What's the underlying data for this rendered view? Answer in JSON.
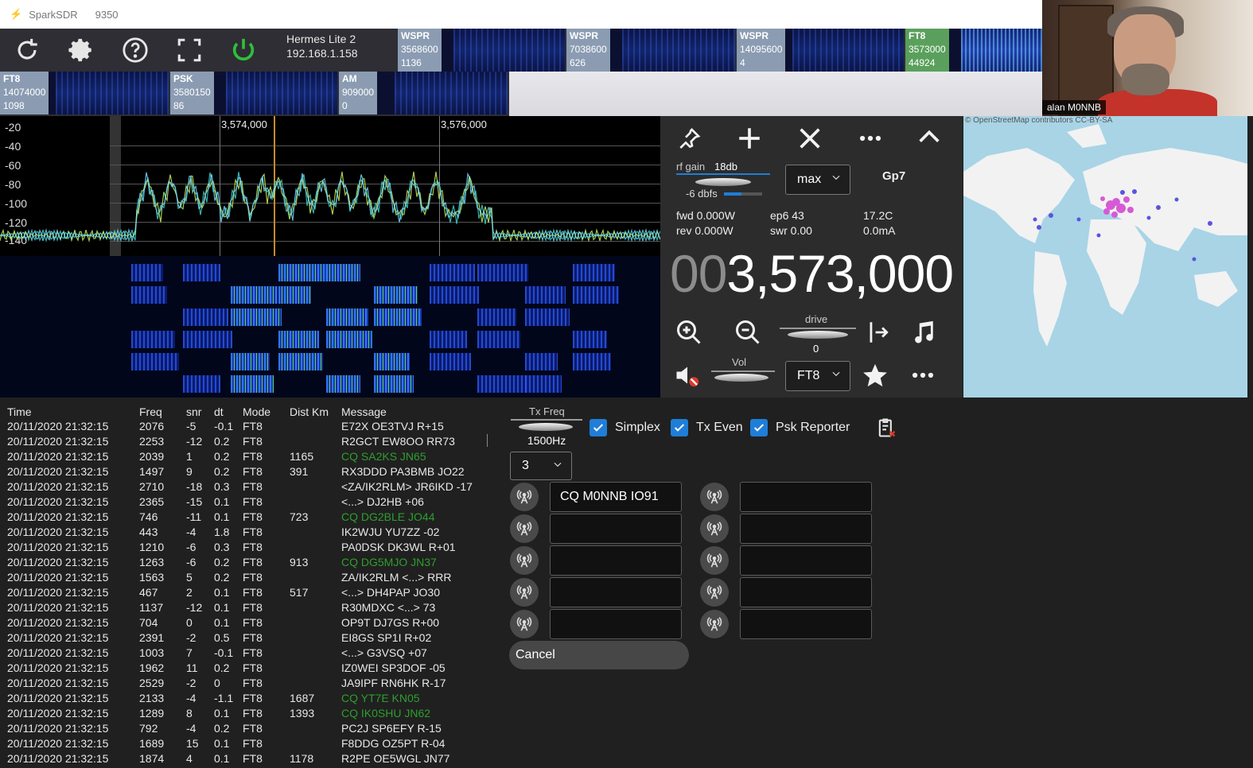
{
  "titlebar": {
    "app": "SparkSDR",
    "number": "9350"
  },
  "radio": {
    "name": "Hermes Lite 2",
    "ip": "192.168.1.158"
  },
  "tiles_row1": [
    {
      "mode": "WSPR",
      "freq": "3568600",
      "count": "1136",
      "green": false
    },
    {
      "mode": "WSPR",
      "freq": "7038600",
      "count": "626",
      "green": false
    },
    {
      "mode": "WSPR",
      "freq": "14095600",
      "count": "4",
      "green": false
    },
    {
      "mode": "FT8",
      "freq": "3573000",
      "count": "44924",
      "green": true
    }
  ],
  "tiles_row2": [
    {
      "mode": "FT8",
      "freq": "14074000",
      "count": "1098",
      "green": false
    },
    {
      "mode": "PSK",
      "freq": "3580150",
      "count": "86",
      "green": false
    },
    {
      "mode": "AM",
      "freq": "909000",
      "count": "0",
      "green": false
    }
  ],
  "video": {
    "name": "alan M0NNB"
  },
  "spectrum": {
    "y_labels": [
      "-20",
      "-40",
      "-60",
      "-80",
      "-100",
      "-120",
      "-140"
    ],
    "x_labels": [
      "3,574,000",
      "3,576,000"
    ]
  },
  "controls": {
    "rf_gain_label": "rf gain",
    "rf_gain_value": "18db",
    "dbfs": "-6 dbfs",
    "agc_select": "max",
    "profile": "Gp7",
    "fwd": "fwd 0.000W",
    "rev": "rev 0.000W",
    "ep6": "ep6 43",
    "swr": "swr 0.00",
    "temp": "17.2C",
    "current": "0.0mA",
    "freq_dim": "00",
    "freq_main": "3,573,000",
    "drive_label": "drive",
    "drive_value": "0",
    "vol_label": "Vol",
    "mode_select": "FT8"
  },
  "map": {
    "attribution": "© OpenStreetMap contributors CC-BY-SA"
  },
  "decodes": {
    "headers": {
      "time": "Time",
      "freq": "Freq",
      "snr": "snr",
      "dt": "dt",
      "mode": "Mode",
      "dist": "Dist Km",
      "msg": "Message"
    },
    "rows": [
      {
        "time": "20/11/2020 21:32:15",
        "freq": "2076",
        "snr": "-5",
        "dt": "-0.1",
        "mode": "FT8",
        "dist": "",
        "msg": "E72X OE3TVJ R+15",
        "cq": false
      },
      {
        "time": "20/11/2020 21:32:15",
        "freq": "2253",
        "snr": "-12",
        "dt": "0.2",
        "mode": "FT8",
        "dist": "",
        "msg": "R2GCT EW8OO RR73",
        "cq": false
      },
      {
        "time": "20/11/2020 21:32:15",
        "freq": "2039",
        "snr": "1",
        "dt": "0.2",
        "mode": "FT8",
        "dist": "1165",
        "msg": "CQ SA2KS JN65",
        "cq": true
      },
      {
        "time": "20/11/2020 21:32:15",
        "freq": "1497",
        "snr": "9",
        "dt": "0.2",
        "mode": "FT8",
        "dist": "391",
        "msg": "RX3DDD PA3BMB JO22",
        "cq": false
      },
      {
        "time": "20/11/2020 21:32:15",
        "freq": "2710",
        "snr": "-18",
        "dt": "0.3",
        "mode": "FT8",
        "dist": "",
        "msg": "<ZA/IK2RLM> JR6IKD -17",
        "cq": false
      },
      {
        "time": "20/11/2020 21:32:15",
        "freq": "2365",
        "snr": "-15",
        "dt": "0.1",
        "mode": "FT8",
        "dist": "",
        "msg": "<...> DJ2HB +06",
        "cq": false
      },
      {
        "time": "20/11/2020 21:32:15",
        "freq": "746",
        "snr": "-11",
        "dt": "0.1",
        "mode": "FT8",
        "dist": "723",
        "msg": "CQ DG2BLE JO44",
        "cq": true
      },
      {
        "time": "20/11/2020 21:32:15",
        "freq": "443",
        "snr": "-4",
        "dt": "1.8",
        "mode": "FT8",
        "dist": "",
        "msg": "IK2WJU YU7ZZ -02",
        "cq": false
      },
      {
        "time": "20/11/2020 21:32:15",
        "freq": "1210",
        "snr": "-6",
        "dt": "0.3",
        "mode": "FT8",
        "dist": "",
        "msg": "PA0DSK DK3WL R+01",
        "cq": false
      },
      {
        "time": "20/11/2020 21:32:15",
        "freq": "1263",
        "snr": "-6",
        "dt": "0.2",
        "mode": "FT8",
        "dist": "913",
        "msg": "CQ DG5MJO JN37",
        "cq": true
      },
      {
        "time": "20/11/2020 21:32:15",
        "freq": "1563",
        "snr": "5",
        "dt": "0.2",
        "mode": "FT8",
        "dist": "",
        "msg": "ZA/IK2RLM <...> RRR",
        "cq": false
      },
      {
        "time": "20/11/2020 21:32:15",
        "freq": "467",
        "snr": "2",
        "dt": "0.1",
        "mode": "FT8",
        "dist": "517",
        "msg": "<...> DH4PAP JO30",
        "cq": false
      },
      {
        "time": "20/11/2020 21:32:15",
        "freq": "1137",
        "snr": "-12",
        "dt": "0.1",
        "mode": "FT8",
        "dist": "",
        "msg": "R30MDXC <...> 73",
        "cq": false
      },
      {
        "time": "20/11/2020 21:32:15",
        "freq": "704",
        "snr": "0",
        "dt": "0.1",
        "mode": "FT8",
        "dist": "",
        "msg": "OP9T DJ7GS R+00",
        "cq": false
      },
      {
        "time": "20/11/2020 21:32:15",
        "freq": "2391",
        "snr": "-2",
        "dt": "0.5",
        "mode": "FT8",
        "dist": "",
        "msg": "EI8GS SP1I R+02",
        "cq": false
      },
      {
        "time": "20/11/2020 21:32:15",
        "freq": "1003",
        "snr": "7",
        "dt": "-0.1",
        "mode": "FT8",
        "dist": "",
        "msg": "<...> G3VSQ +07",
        "cq": false
      },
      {
        "time": "20/11/2020 21:32:15",
        "freq": "1962",
        "snr": "11",
        "dt": "0.2",
        "mode": "FT8",
        "dist": "",
        "msg": "IZ0WEI SP3DOF -05",
        "cq": false
      },
      {
        "time": "20/11/2020 21:32:15",
        "freq": "2529",
        "snr": "-2",
        "dt": "0",
        "mode": "FT8",
        "dist": "",
        "msg": "JA9IPF RN6HK R-17",
        "cq": false
      },
      {
        "time": "20/11/2020 21:32:15",
        "freq": "2133",
        "snr": "-4",
        "dt": "-1.1",
        "mode": "FT8",
        "dist": "1687",
        "msg": "CQ YT7E KN05",
        "cq": true
      },
      {
        "time": "20/11/2020 21:32:15",
        "freq": "1289",
        "snr": "8",
        "dt": "0.1",
        "mode": "FT8",
        "dist": "1393",
        "msg": "CQ IK0SHU JN62",
        "cq": true
      },
      {
        "time": "20/11/2020 21:32:15",
        "freq": "792",
        "snr": "-4",
        "dt": "0.2",
        "mode": "FT8",
        "dist": "",
        "msg": "PC2J SP6EFY R-15",
        "cq": false
      },
      {
        "time": "20/11/2020 21:32:15",
        "freq": "1689",
        "snr": "15",
        "dt": "0.1",
        "mode": "FT8",
        "dist": "",
        "msg": "F8DDG OZ5PT R-04",
        "cq": false
      },
      {
        "time": "20/11/2020 21:32:15",
        "freq": "1874",
        "snr": "4",
        "dt": "0.1",
        "mode": "FT8",
        "dist": "1178",
        "msg": "R2PE OE5WGL JN77",
        "cq": false
      }
    ]
  },
  "tx": {
    "tx_freq_label": "Tx Freq",
    "tx_freq_value": "1500Hz",
    "simplex": "Simplex",
    "tx_even": "Tx Even",
    "psk_reporter": "Psk Reporter",
    "slot_select": "3",
    "messages_left": [
      "CQ M0NNB IO91",
      "",
      "",
      "",
      ""
    ],
    "messages_right": [
      "",
      "",
      "",
      "",
      ""
    ],
    "cancel": "Cancel"
  },
  "colors": {
    "accent": "#1f7ed8",
    "cq_green": "#2e9e2e",
    "tile_label": "#8b9cb2",
    "tile_active": "#5aa05c"
  }
}
